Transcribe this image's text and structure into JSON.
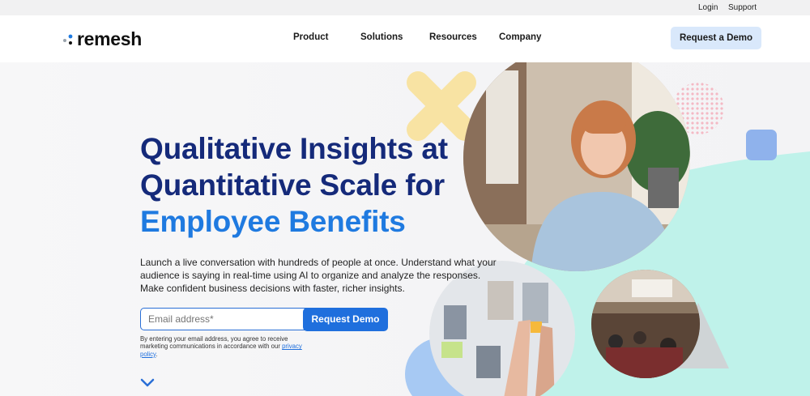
{
  "utility_nav": {
    "login": "Login",
    "support": "Support"
  },
  "header": {
    "logo_text": "remesh",
    "nav": [
      "Product",
      "Solutions",
      "Resources",
      "Company"
    ],
    "cta": "Request a Demo"
  },
  "hero": {
    "headline_line1": "Qualitative Insights at",
    "headline_line2": "Quantitative Scale for",
    "headline_line3": "Employee Benefits",
    "body": "Launch a live conversation with hundreds of people at once. Understand what your audience is saying in real-time using AI to organize and analyze the responses. Make confident business decisions with faster, richer insights.",
    "email_placeholder": "Email address*",
    "submit_label": "Request Demo",
    "disclaimer": "By entering your email address, you agree to receive marketing communications in accordance with our",
    "privacy_link": "privacy policy",
    "disclaimer_end": "."
  },
  "icons": {
    "scroll": "chevron-down-icon",
    "logo": "remesh-dots-icon"
  },
  "colors": {
    "headline_navy": "#152a7a",
    "headline_accent": "#1f7ae0",
    "button_blue": "#1f6fdd",
    "cta_light": "#d9e8fb",
    "mint": "#bff2ea",
    "yellow_x": "#f8e3a3",
    "pink_dots": "#f4b9c4"
  }
}
